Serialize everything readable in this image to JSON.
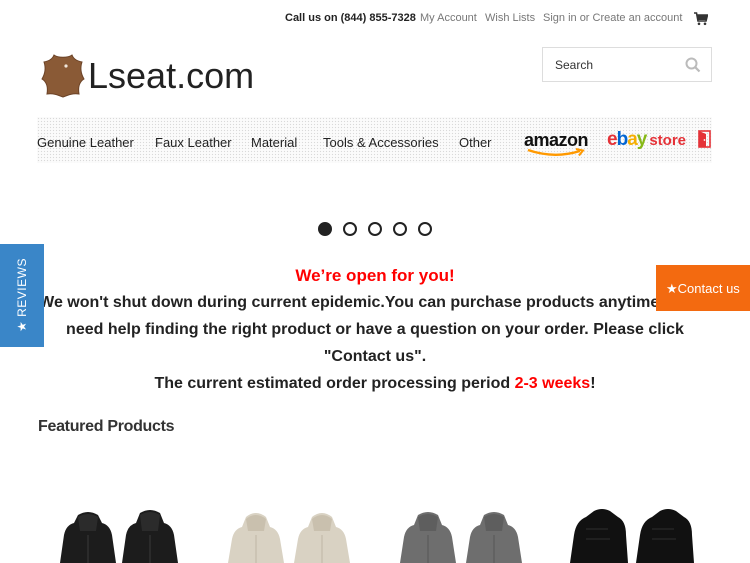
{
  "topbar": {
    "phone": "Call us on (844) 855-7328",
    "links": [
      "My Account",
      "Wish Lists",
      "Sign in or Create an account"
    ]
  },
  "logo": {
    "text": "Lseat.com"
  },
  "search": {
    "placeholder": "Search"
  },
  "nav": {
    "items": [
      "Genuine Leather",
      "Faux Leather",
      "Material",
      "Tools & Accessories",
      "Other"
    ],
    "amazon": "amazon",
    "ebay": {
      "e": "e",
      "b": "b",
      "a": "a",
      "y": "y",
      "store": "store"
    }
  },
  "carousel": {
    "slide_count": 5,
    "active_slide": 1
  },
  "announcement": {
    "headline": "We’re open for you!",
    "body": "We won't shut down during current epidemic.You can purchase products anytime. If you need help finding the right product or have a question on your order. Please click \"Contact us\".",
    "processing_prefix": "The current estimated order processing period ",
    "processing_period": "2-3 weeks",
    "processing_suffix": "!"
  },
  "reviews_tab": {
    "label": "★ REVIEWS"
  },
  "contact_tab": {
    "label": "★Contact us"
  },
  "featured": {
    "title": "Featured Products"
  },
  "products": [
    {
      "name": "black-leather-seat-covers"
    },
    {
      "name": "beige-leather-seat-covers"
    },
    {
      "name": "gray-leather-seat-covers"
    },
    {
      "name": "black-perforated-seat-covers"
    }
  ],
  "colors": {
    "accent_red": "#ff0000",
    "reviews_blue": "#3a86c8",
    "contact_orange": "#f36a10",
    "ebay_red": "#e53238",
    "ebay_blue": "#0064d2",
    "ebay_yellow": "#f5af02",
    "ebay_green": "#86b817"
  }
}
